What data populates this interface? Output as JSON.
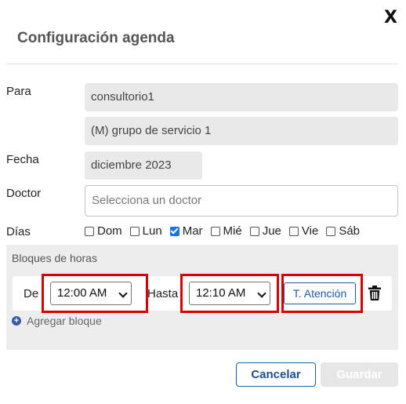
{
  "dialog": {
    "title": "Configuración agenda",
    "close_label": "X"
  },
  "form": {
    "para_label": "Para",
    "para_value": "consultorio1",
    "group_value": "(M) grupo de servicio 1",
    "fecha_label": "Fecha",
    "fecha_value": "diciembre 2023",
    "doctor_label": "Doctor",
    "doctor_placeholder": "Selecciona un doctor",
    "dias_label": "Días",
    "days": [
      {
        "label": "Dom",
        "checked": false
      },
      {
        "label": "Lun",
        "checked": false
      },
      {
        "label": "Mar",
        "checked": true
      },
      {
        "label": "Mié",
        "checked": false
      },
      {
        "label": "Jue",
        "checked": false
      },
      {
        "label": "Vie",
        "checked": false
      },
      {
        "label": "Sáb",
        "checked": false
      }
    ]
  },
  "blocks": {
    "title": "Bloques de horas",
    "de_label": "De",
    "de_value": "12:00 AM",
    "hasta_label": "Hasta",
    "hasta_value": "12:10 AM",
    "attention_button": "T. Atención",
    "add_block_label": "Agregar bloque"
  },
  "footer": {
    "cancel_label": "Cancelar",
    "save_label": "Guardar"
  },
  "colors": {
    "accent": "#1f5aa6",
    "highlight": "#d60000",
    "checkbox_checked": "#1a73e8"
  },
  "icons": {
    "close": "close-icon",
    "trash": "trash-icon",
    "add": "plus-circle-icon"
  }
}
